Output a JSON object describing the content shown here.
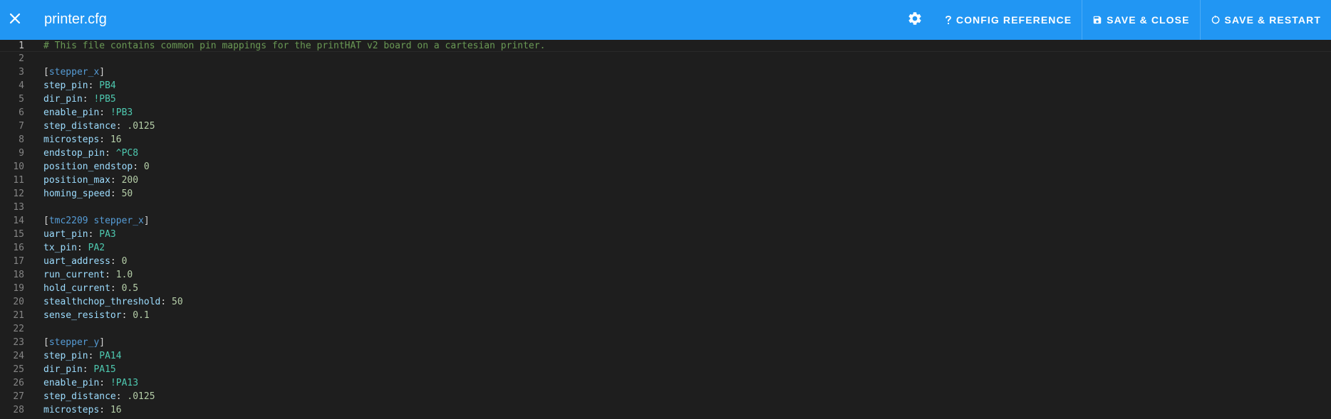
{
  "toolbar": {
    "title": "printer.cfg",
    "config_reference_label": "CONFIG REFERENCE",
    "save_close_label": "SAVE & CLOSE",
    "save_restart_label": "SAVE & RESTART",
    "icons": {
      "close": "close-icon",
      "settings": "gear-icon",
      "help": "question-mark-icon",
      "save": "floppy-disk-icon",
      "restart": "restart-icon"
    },
    "colors": {
      "background": "#2196f3",
      "text": "#ffffff"
    }
  },
  "editor": {
    "current_line": 1,
    "colors": {
      "background": "#1e1e1e",
      "comment": "#6a9955",
      "key": "#9cdcfe",
      "section": "#569cd6",
      "pin": "#4ec9b0",
      "number": "#b5cea8",
      "line_number": "#858585"
    },
    "lines": [
      {
        "n": "1",
        "tokens": [
          {
            "t": "comment",
            "v": "# This file contains common pin mappings for the printHAT v2 board on a cartesian printer."
          }
        ]
      },
      {
        "n": "2",
        "tokens": []
      },
      {
        "n": "3",
        "tokens": [
          {
            "t": "punct",
            "v": "["
          },
          {
            "t": "section",
            "v": "stepper_x"
          },
          {
            "t": "punct",
            "v": "]"
          }
        ]
      },
      {
        "n": "4",
        "tokens": [
          {
            "t": "key",
            "v": "step_pin"
          },
          {
            "t": "punct",
            "v": ": "
          },
          {
            "t": "pin",
            "v": "PB4"
          }
        ]
      },
      {
        "n": "5",
        "tokens": [
          {
            "t": "key",
            "v": "dir_pin"
          },
          {
            "t": "punct",
            "v": ": "
          },
          {
            "t": "pin",
            "v": "!PB5"
          }
        ]
      },
      {
        "n": "6",
        "tokens": [
          {
            "t": "key",
            "v": "enable_pin"
          },
          {
            "t": "punct",
            "v": ": "
          },
          {
            "t": "pin",
            "v": "!PB3"
          }
        ]
      },
      {
        "n": "7",
        "tokens": [
          {
            "t": "key",
            "v": "step_distance"
          },
          {
            "t": "punct",
            "v": ": "
          },
          {
            "t": "num",
            "v": ".0125"
          }
        ]
      },
      {
        "n": "8",
        "tokens": [
          {
            "t": "key",
            "v": "microsteps"
          },
          {
            "t": "punct",
            "v": ": "
          },
          {
            "t": "num",
            "v": "16"
          }
        ]
      },
      {
        "n": "9",
        "tokens": [
          {
            "t": "key",
            "v": "endstop_pin"
          },
          {
            "t": "punct",
            "v": ": "
          },
          {
            "t": "pin",
            "v": "^PC8"
          }
        ]
      },
      {
        "n": "10",
        "tokens": [
          {
            "t": "key",
            "v": "position_endstop"
          },
          {
            "t": "punct",
            "v": ": "
          },
          {
            "t": "num",
            "v": "0"
          }
        ]
      },
      {
        "n": "11",
        "tokens": [
          {
            "t": "key",
            "v": "position_max"
          },
          {
            "t": "punct",
            "v": ": "
          },
          {
            "t": "num",
            "v": "200"
          }
        ]
      },
      {
        "n": "12",
        "tokens": [
          {
            "t": "key",
            "v": "homing_speed"
          },
          {
            "t": "punct",
            "v": ": "
          },
          {
            "t": "num",
            "v": "50"
          }
        ]
      },
      {
        "n": "13",
        "tokens": []
      },
      {
        "n": "14",
        "tokens": [
          {
            "t": "punct",
            "v": "["
          },
          {
            "t": "section",
            "v": "tmc2209 stepper_x"
          },
          {
            "t": "punct",
            "v": "]"
          }
        ]
      },
      {
        "n": "15",
        "tokens": [
          {
            "t": "key",
            "v": "uart_pin"
          },
          {
            "t": "punct",
            "v": ": "
          },
          {
            "t": "pin",
            "v": "PA3"
          }
        ]
      },
      {
        "n": "16",
        "tokens": [
          {
            "t": "key",
            "v": "tx_pin"
          },
          {
            "t": "punct",
            "v": ": "
          },
          {
            "t": "pin",
            "v": "PA2"
          }
        ]
      },
      {
        "n": "17",
        "tokens": [
          {
            "t": "key",
            "v": "uart_address"
          },
          {
            "t": "punct",
            "v": ": "
          },
          {
            "t": "num",
            "v": "0"
          }
        ]
      },
      {
        "n": "18",
        "tokens": [
          {
            "t": "key",
            "v": "run_current"
          },
          {
            "t": "punct",
            "v": ": "
          },
          {
            "t": "num",
            "v": "1.0"
          }
        ]
      },
      {
        "n": "19",
        "tokens": [
          {
            "t": "key",
            "v": "hold_current"
          },
          {
            "t": "punct",
            "v": ": "
          },
          {
            "t": "num",
            "v": "0.5"
          }
        ]
      },
      {
        "n": "20",
        "tokens": [
          {
            "t": "key",
            "v": "stealthchop_threshold"
          },
          {
            "t": "punct",
            "v": ": "
          },
          {
            "t": "num",
            "v": "50"
          }
        ]
      },
      {
        "n": "21",
        "tokens": [
          {
            "t": "key",
            "v": "sense_resistor"
          },
          {
            "t": "punct",
            "v": ": "
          },
          {
            "t": "num",
            "v": "0.1"
          }
        ]
      },
      {
        "n": "22",
        "tokens": []
      },
      {
        "n": "23",
        "tokens": [
          {
            "t": "punct",
            "v": "["
          },
          {
            "t": "section",
            "v": "stepper_y"
          },
          {
            "t": "punct",
            "v": "]"
          }
        ]
      },
      {
        "n": "24",
        "tokens": [
          {
            "t": "key",
            "v": "step_pin"
          },
          {
            "t": "punct",
            "v": ": "
          },
          {
            "t": "pin",
            "v": "PA14"
          }
        ]
      },
      {
        "n": "25",
        "tokens": [
          {
            "t": "key",
            "v": "dir_pin"
          },
          {
            "t": "punct",
            "v": ": "
          },
          {
            "t": "pin",
            "v": "PA15"
          }
        ]
      },
      {
        "n": "26",
        "tokens": [
          {
            "t": "key",
            "v": "enable_pin"
          },
          {
            "t": "punct",
            "v": ": "
          },
          {
            "t": "pin",
            "v": "!PA13"
          }
        ]
      },
      {
        "n": "27",
        "tokens": [
          {
            "t": "key",
            "v": "step_distance"
          },
          {
            "t": "punct",
            "v": ": "
          },
          {
            "t": "num",
            "v": ".0125"
          }
        ]
      },
      {
        "n": "28",
        "tokens": [
          {
            "t": "key",
            "v": "microsteps"
          },
          {
            "t": "punct",
            "v": ": "
          },
          {
            "t": "num",
            "v": "16"
          }
        ]
      }
    ]
  }
}
